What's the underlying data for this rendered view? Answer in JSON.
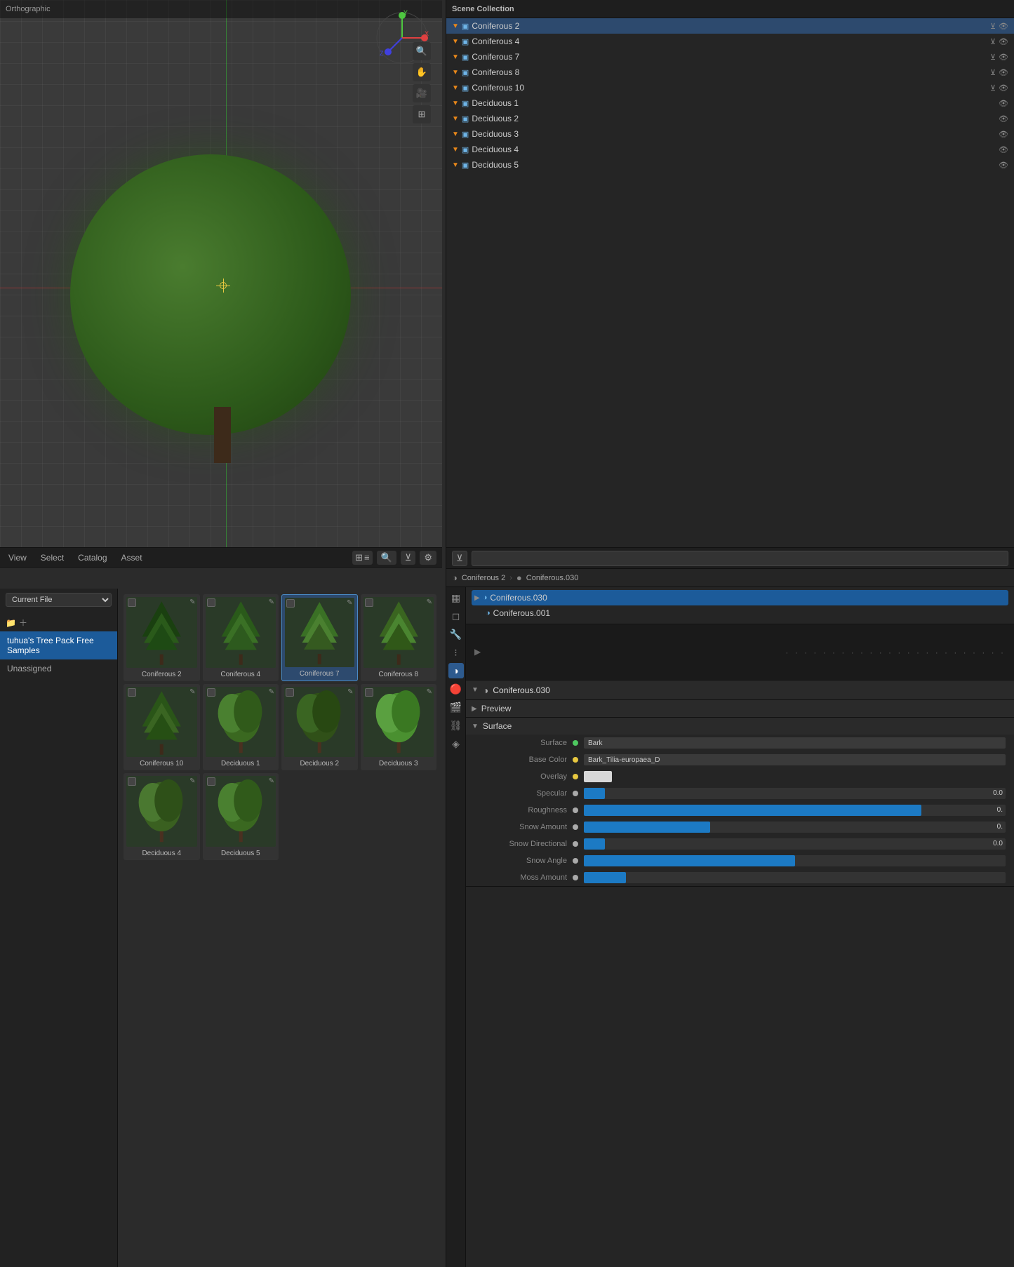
{
  "app": {
    "title": "Orthographic",
    "breadcrumb": "Scene Collection | Coniferous 2"
  },
  "viewport": {
    "mode_label": "Orthographic"
  },
  "outliner": {
    "title": "Scene Collection",
    "items": [
      {
        "id": 1,
        "label": "Coniferous 2",
        "has_filter": true,
        "selected": true
      },
      {
        "id": 2,
        "label": "Coniferous 4",
        "has_filter": true,
        "selected": false
      },
      {
        "id": 3,
        "label": "Coniferous 7",
        "has_filter": true,
        "selected": false
      },
      {
        "id": 4,
        "label": "Coniferous 8",
        "has_filter": true,
        "selected": false
      },
      {
        "id": 5,
        "label": "Coniferous 10",
        "has_filter": true,
        "selected": false
      },
      {
        "id": 6,
        "label": "Deciduous 1",
        "has_filter": false,
        "selected": false
      },
      {
        "id": 7,
        "label": "Deciduous 2",
        "has_filter": false,
        "selected": false
      },
      {
        "id": 8,
        "label": "Deciduous 3",
        "has_filter": false,
        "selected": false
      },
      {
        "id": 9,
        "label": "Deciduous 4",
        "has_filter": false,
        "selected": false
      },
      {
        "id": 10,
        "label": "Deciduous 5",
        "has_filter": false,
        "selected": false
      }
    ]
  },
  "asset_browser": {
    "menu": {
      "view_label": "View",
      "select_label": "Select",
      "catalog_label": "Catalog",
      "asset_label": "Asset"
    },
    "sidebar": {
      "source_label": "Current File",
      "library_label": "tuhua's Tree Pack Free Samples",
      "unassigned_label": "Unassigned"
    },
    "assets": [
      {
        "id": 1,
        "name": "Coniferous 2",
        "selected": false,
        "tree_type": "conical_dark"
      },
      {
        "id": 2,
        "name": "Coniferous 4",
        "selected": false,
        "tree_type": "conical_medium"
      },
      {
        "id": 3,
        "name": "Coniferous 7",
        "selected": true,
        "tree_type": "conical_selected"
      },
      {
        "id": 4,
        "name": "Coniferous 8",
        "selected": false,
        "tree_type": "conical_light"
      },
      {
        "id": 5,
        "name": "Coniferous 10",
        "selected": false,
        "tree_type": "conical_short"
      },
      {
        "id": 6,
        "name": "Deciduous 1",
        "selected": false,
        "tree_type": "deciduous_round"
      },
      {
        "id": 7,
        "name": "Deciduous 2",
        "selected": false,
        "tree_type": "deciduous_tall"
      },
      {
        "id": 8,
        "name": "Deciduous 3",
        "selected": false,
        "tree_type": "deciduous_bright"
      },
      {
        "id": 9,
        "name": "Deciduous 4",
        "selected": false,
        "tree_type": "deciduous_small"
      },
      {
        "id": 10,
        "name": "Deciduous 5",
        "selected": false,
        "tree_type": "deciduous_wide"
      }
    ]
  },
  "properties": {
    "search_placeholder": "",
    "breadcrumb": {
      "collection": "Coniferous 2",
      "object": "Coniferous.030"
    },
    "collection_items": [
      {
        "id": 1,
        "label": "Coniferous.030",
        "selected": true
      },
      {
        "id": 2,
        "label": "Coniferous.001",
        "selected": false
      }
    ],
    "material_name": "Coniferous.030",
    "sections": {
      "preview_label": "Preview",
      "surface_label": "Surface"
    },
    "surface_value": "Bark",
    "props": [
      {
        "key": "base_color_label",
        "label": "Base Color",
        "value": "Bark_Tilia-europaea_D",
        "type": "texture",
        "dot": "yellow"
      },
      {
        "key": "overlay_label",
        "label": "Overlay",
        "value": "",
        "type": "color",
        "dot": "yellow",
        "color": "#e8e8e8"
      },
      {
        "key": "specular_label",
        "label": "Specular",
        "value": "0.0",
        "type": "bar",
        "dot": "dot",
        "bar_width": "5%"
      },
      {
        "key": "roughness_label",
        "label": "Roughness",
        "value": "0.",
        "type": "bar_blue",
        "dot": "dot",
        "bar_width": "80%"
      },
      {
        "key": "snow_amount_label",
        "label": "Snow Amount",
        "value": "0.",
        "type": "bar_blue",
        "dot": "dot",
        "bar_width": "30%"
      },
      {
        "key": "snow_dir_label",
        "label": "Snow Directional",
        "value": "0.0",
        "type": "bar",
        "dot": "dot",
        "bar_width": "5%"
      },
      {
        "key": "snow_angle_label",
        "label": "Snow Angle",
        "value": "",
        "type": "bar",
        "dot": "dot",
        "bar_width": "50%"
      },
      {
        "key": "moss_amount_label",
        "label": "Moss Amount",
        "value": "",
        "type": "bar",
        "dot": "dot",
        "bar_width": "10%"
      }
    ]
  },
  "colors": {
    "accent_blue": "#1c7ac4",
    "accent_orange": "#e8871a",
    "active_blue": "#1c5b9a",
    "green_tree": "#4a7c2f"
  }
}
